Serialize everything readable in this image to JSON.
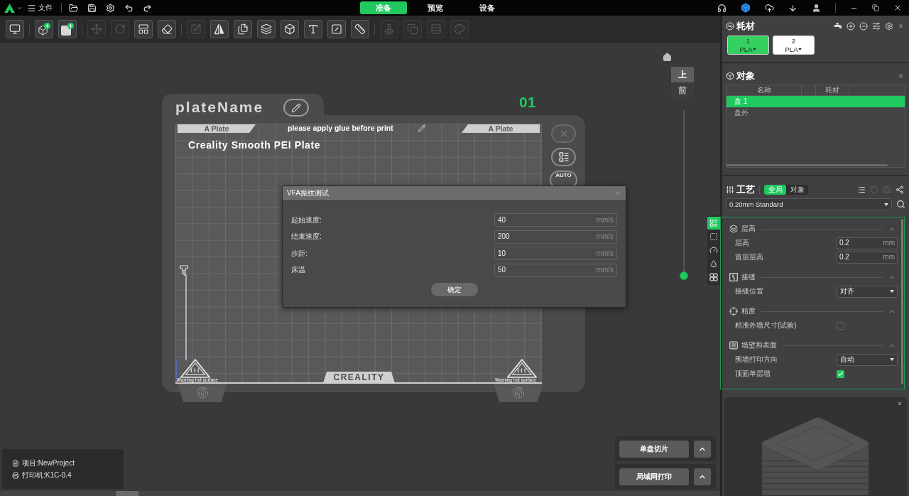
{
  "top_bar": {
    "file_menu": "文件",
    "mode_tabs": [
      {
        "label": "准备",
        "selected": true
      },
      {
        "label": "预览",
        "selected": false
      },
      {
        "label": "设备",
        "selected": false
      }
    ]
  },
  "toolbar": {
    "groups": [
      [
        {
          "disabled": false
        }
      ],
      [
        {
          "disabled": false
        },
        {
          "disabled": false
        }
      ],
      [
        {
          "disabled": true
        },
        {
          "disabled": true
        },
        {
          "disabled": false
        },
        {
          "disabled": false
        }
      ],
      [
        {
          "disabled": true
        },
        {
          "disabled": false
        },
        {
          "disabled": false
        },
        {
          "disabled": false
        },
        {
          "disabled": false
        },
        {
          "disabled": false
        },
        {
          "disabled": false
        },
        {
          "disabled": false
        }
      ],
      [
        {
          "disabled": true
        },
        {
          "disabled": true
        },
        {
          "disabled": true
        },
        {
          "disabled": true
        }
      ]
    ]
  },
  "plate": {
    "name": "plateName",
    "number": "01",
    "strip_labels": [
      "A Plate",
      "please apply glue before print",
      "A Plate"
    ],
    "bed_name": "Creality Smooth PEI Plate",
    "brand_label": "CREALITY",
    "warnings": [
      "Warning hot surface",
      "Warning hot surface"
    ],
    "auto_label": "AUTO"
  },
  "view_controls": {
    "views": [
      {
        "label": "上",
        "selected": true
      },
      {
        "label": "前",
        "selected": false
      }
    ],
    "layer_slider": {
      "level": 0
    }
  },
  "side_tabs": [
    {
      "selected": true
    },
    {
      "selected": false
    },
    {
      "selected": false
    },
    {
      "selected": false
    },
    {
      "selected": false
    }
  ],
  "dialog": {
    "title": "VFA振纹测试",
    "fields": [
      {
        "label": "起始速度:",
        "value": "40",
        "unit": "mm/s"
      },
      {
        "label": "结束速度:",
        "value": "200",
        "unit": "mm/s"
      },
      {
        "label": "步距:",
        "value": "10",
        "unit": "mm/s"
      },
      {
        "label": "床温",
        "value": "50",
        "unit": "mm/s"
      }
    ],
    "confirm": "确定"
  },
  "project_info": {
    "project": "项目:NewProject",
    "printer": "打印机:K1C-0.4"
  },
  "actions": [
    "单盘切片",
    "局域网打印"
  ],
  "filament": {
    "title": "耗材",
    "slots": [
      {
        "number": "1",
        "material": "PLA",
        "color": "#34d160"
      },
      {
        "number": "2",
        "material": "PLA",
        "color": "#ffffff"
      }
    ]
  },
  "objects": {
    "title": "对象",
    "columns": [
      "名称",
      "耗材"
    ],
    "rows": [
      {
        "name": "盘 1",
        "selected": true
      },
      {
        "name": "盘外",
        "selected": false
      }
    ]
  },
  "process": {
    "title": "工艺",
    "scope_tabs": [
      {
        "label": "全局",
        "selected": true
      },
      {
        "label": "对象",
        "selected": false
      }
    ],
    "actions": [
      {
        "disabled": false
      },
      {
        "disabled": true
      },
      {
        "disabled": true
      },
      {
        "disabled": false
      }
    ],
    "preset": "0.20mm Standard",
    "groups": [
      {
        "title": "层高",
        "expanded": true,
        "settings": [
          {
            "kind": "number",
            "label": "层高",
            "value": "0.2",
            "unit": "mm"
          },
          {
            "kind": "number",
            "label": "首层层高",
            "value": "0.2",
            "unit": "mm"
          }
        ]
      },
      {
        "title": "接缝",
        "expanded": true,
        "settings": [
          {
            "kind": "select",
            "label": "接缝位置",
            "value": "对齐"
          }
        ]
      },
      {
        "title": "精度",
        "expanded": true,
        "settings": [
          {
            "kind": "checkbox",
            "label": "精准外墙尺寸(试验)",
            "checked": false
          }
        ]
      },
      {
        "title": "墙壁和表面",
        "expanded": true,
        "settings": [
          {
            "kind": "select",
            "label": "围墙打印方向",
            "value": "自动"
          },
          {
            "kind": "checkbox",
            "label": "顶面单层墙",
            "checked": true
          }
        ]
      }
    ]
  }
}
